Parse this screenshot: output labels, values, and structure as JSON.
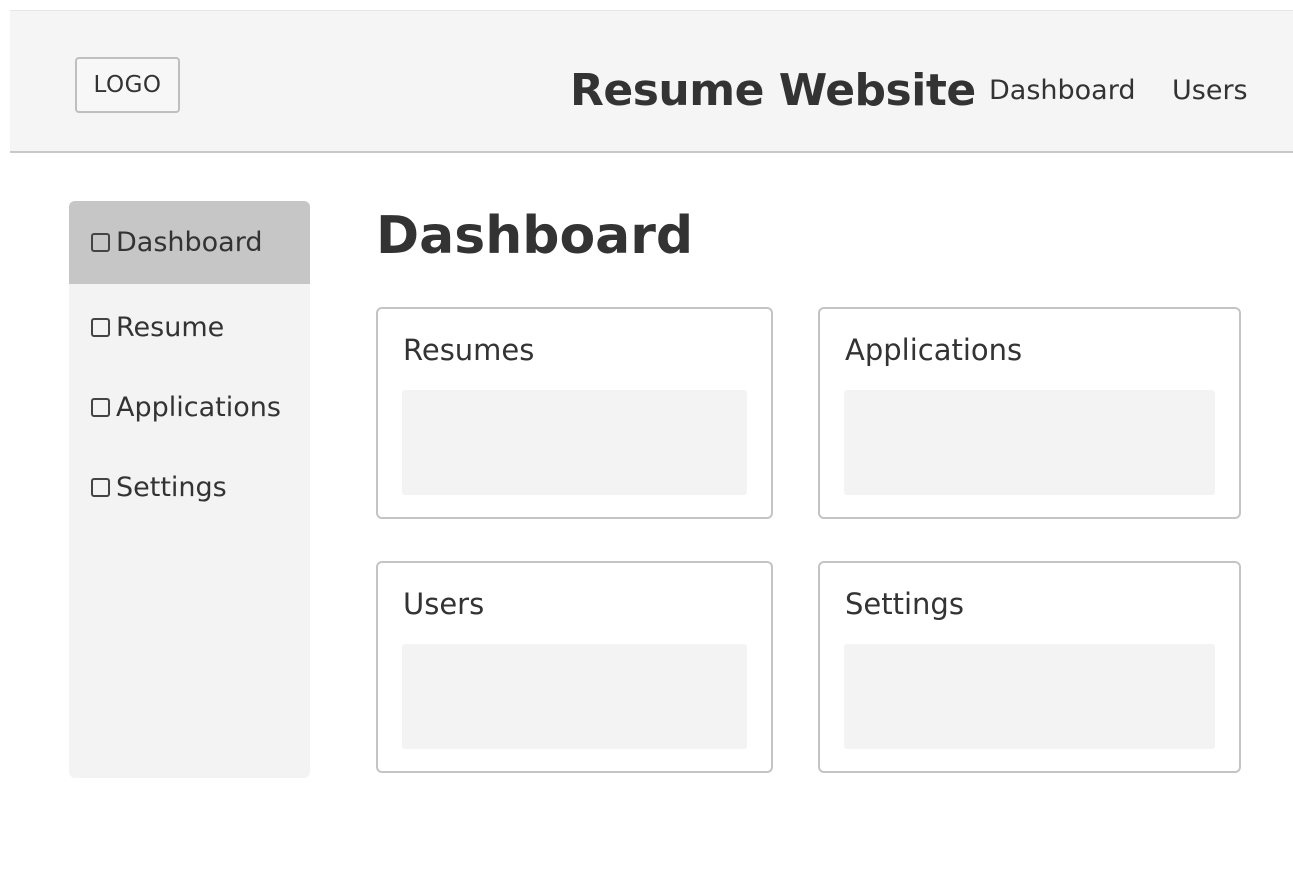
{
  "header": {
    "logo": "LOGO",
    "title": "Resume Website",
    "nav": {
      "dashboard": "Dashboard",
      "users": "Users"
    }
  },
  "sidebar": {
    "items": [
      {
        "label": "Dashboard",
        "active": true
      },
      {
        "label": "Resume",
        "active": false
      },
      {
        "label": "Applications",
        "active": false
      },
      {
        "label": "Settings",
        "active": false
      }
    ]
  },
  "main": {
    "title": "Dashboard",
    "cards": [
      {
        "title": "Resumes"
      },
      {
        "title": "Applications"
      },
      {
        "title": "Users"
      },
      {
        "title": "Settings"
      }
    ]
  },
  "colors": {
    "header_bg": "#f5f5f5",
    "sidebar_bg": "#f3f3f3",
    "active_item_bg": "#c6c6c6",
    "card_border": "#c4c4c4",
    "text": "#333333"
  }
}
